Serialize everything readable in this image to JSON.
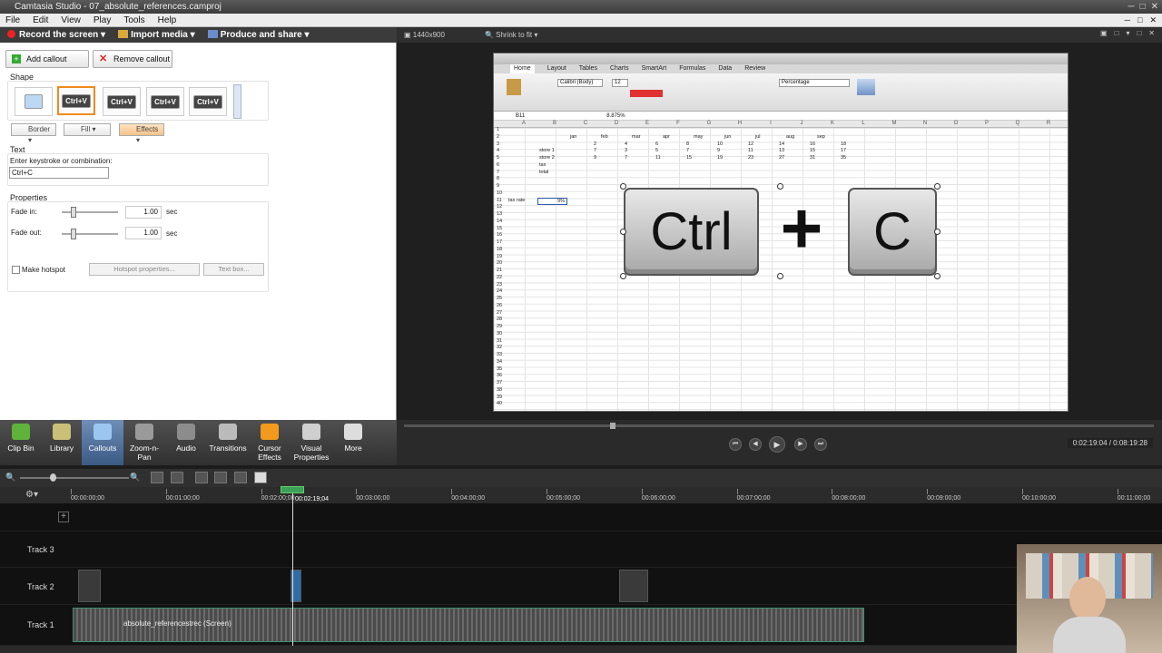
{
  "app": {
    "title": "Camtasia Studio - 07_absolute_references.camproj"
  },
  "menubar": {
    "items": [
      "File",
      "Edit",
      "View",
      "Play",
      "Tools",
      "Help"
    ]
  },
  "toolbar": {
    "record": "Record the screen",
    "import": "Import media",
    "produce": "Produce and share"
  },
  "callouts": {
    "add": "Add callout",
    "remove": "Remove callout",
    "shape_label": "Shape",
    "shapes": [
      "Ctrl+V",
      "Ctrl+V",
      "Ctrl+V",
      "Ctrl+V"
    ],
    "border": "Border",
    "fill": "Fill",
    "effects": "Effects",
    "text_label": "Text",
    "keystroke_prompt": "Enter keystroke or combination:",
    "keystroke_value": "Ctrl+C",
    "properties_label": "Properties",
    "fade_in_label": "Fade in:",
    "fade_in_value": "1.00",
    "fade_out_label": "Fade out:",
    "fade_out_value": "1.00",
    "unit": "sec",
    "hotspot_label": "Make hotspot",
    "hotspot_props": "Hotspot properties...",
    "text_box": "Text box..."
  },
  "tasks": [
    {
      "label": "Clip Bin",
      "color": "#5fb23a"
    },
    {
      "label": "Library",
      "color": "#c9c07a"
    },
    {
      "label": "Callouts",
      "color": "#9cc6f0"
    },
    {
      "label": "Zoom-n-Pan",
      "color": "#9a9a9a"
    },
    {
      "label": "Audio",
      "color": "#8c8c8c"
    },
    {
      "label": "Transitions",
      "color": "#bbbbbb"
    },
    {
      "label": "Cursor Effects",
      "color": "#f39a1e"
    },
    {
      "label": "Visual Properties",
      "color": "#cfcfcf"
    },
    {
      "label": "More",
      "color": "#dddddd"
    }
  ],
  "preview": {
    "resolution": "1440x900",
    "fit": "Shrink to fit",
    "timecode": "0:02:19:04 / 0:08:19:28"
  },
  "excel": {
    "tabs": [
      "Home",
      "Layout",
      "Tables",
      "Charts",
      "SmartArt",
      "Formulas",
      "Data",
      "Review"
    ],
    "font": "Calibri (Body)",
    "size": "12",
    "number_format": "Percentage",
    "cell_ref": "B11",
    "formula": "8.875%",
    "months": [
      "jan",
      "feb",
      "mar",
      "apr",
      "may",
      "jun",
      "jul",
      "aug",
      "sep"
    ],
    "rows": [
      {
        "label": "",
        "values": [
          "2",
          "4",
          "6",
          "8",
          "10",
          "12",
          "14",
          "16",
          "18"
        ]
      },
      {
        "label": "store 1",
        "values": [
          "7",
          "3",
          "5",
          "7",
          "9",
          "11",
          "13",
          "15",
          "17"
        ]
      },
      {
        "label": "store 2",
        "values": [
          "9",
          "7",
          "11",
          "15",
          "19",
          "23",
          "27",
          "31",
          "35"
        ]
      },
      {
        "label": "tax",
        "values": []
      },
      {
        "label": "total",
        "values": []
      }
    ],
    "tax_rate_label": "tax rate",
    "tax_rate_value": "9%",
    "col_letters": [
      "A",
      "B",
      "C",
      "D",
      "E",
      "F",
      "G",
      "H",
      "I",
      "J",
      "K",
      "L",
      "M",
      "N",
      "O",
      "P",
      "Q",
      "R"
    ]
  },
  "callout_keys": {
    "key1": "Ctrl",
    "plus": "+",
    "key2": "C"
  },
  "timeline": {
    "ticks": [
      "00:00:00;00",
      "00:01:00;00",
      "00:02:00;00",
      "00:03:00;00",
      "00:04:00;00",
      "00:05:00;00",
      "00:06:00;00",
      "00:07:00;00",
      "00:08:00;00",
      "00:09:00;00",
      "00:10:00;00",
      "00:11:00;00"
    ],
    "playhead": "00:02:19;04",
    "tracks": [
      "Track 3",
      "Track 2",
      "Track 1"
    ],
    "clip_name": "absolute_referencestrec (Screen)"
  }
}
